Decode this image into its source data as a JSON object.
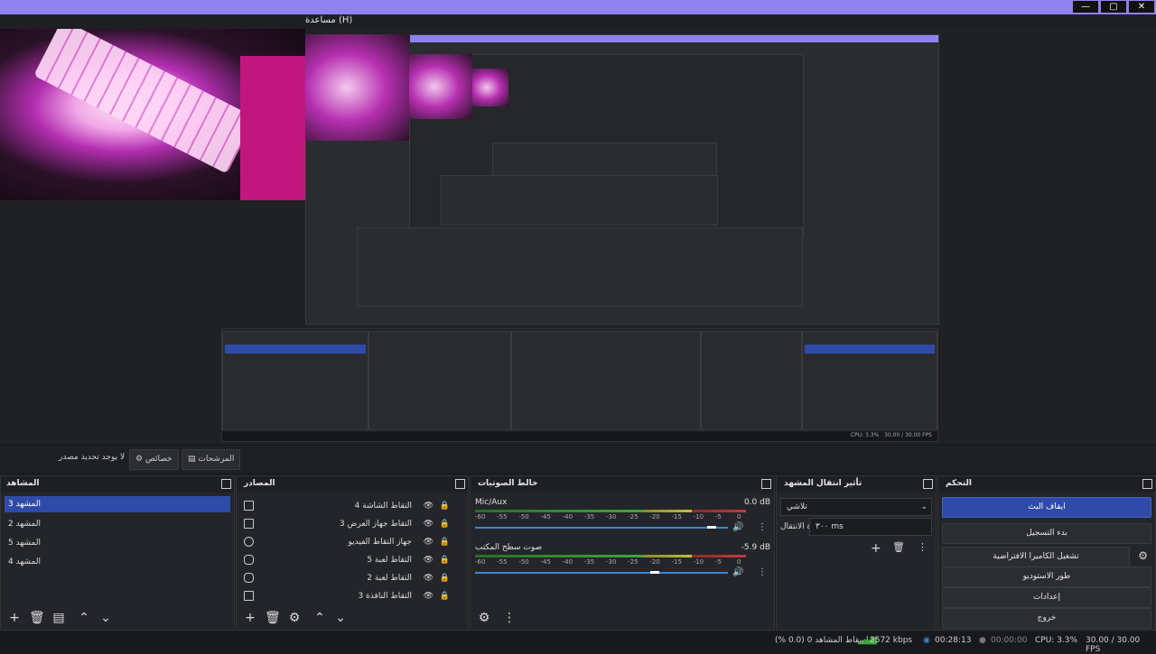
{
  "window": {
    "menu_text": "مساعدة (H)",
    "buttons": [
      "—",
      "▢",
      "✕"
    ]
  },
  "toolbar": {
    "source_label": "لا يوجد تحديد مصدر",
    "properties": "خصائص",
    "filters": "المرشحات"
  },
  "scenes": {
    "title": "المشاهد",
    "items": [
      "المشهد 3",
      "المشهد 2",
      "المشهد 5",
      "المشهد 4"
    ],
    "selected_index": 0
  },
  "sources": {
    "title": "المصادر",
    "items": [
      {
        "name": "التقاط الشاشة 4",
        "icon": "monitor-icon"
      },
      {
        "name": "التقاط جهاز العرض 3",
        "icon": "display-icon"
      },
      {
        "name": "جهاز التقاط الفيديو",
        "icon": "camera-icon"
      },
      {
        "name": "التقاط لعبة 5",
        "icon": "gamepad-icon"
      },
      {
        "name": "التقاط لعبة 2",
        "icon": "gamepad-icon"
      },
      {
        "name": "التقاط النافذة 3",
        "icon": "window-icon"
      }
    ]
  },
  "mixer": {
    "title": "خالط الصوتيات",
    "scale_labels": [
      "-60",
      "-55",
      "-50",
      "-45",
      "-40",
      "-35",
      "-30",
      "-25",
      "-20",
      "-15",
      "-10",
      "-5",
      "0"
    ],
    "channels": [
      {
        "name": "Mic/Aux",
        "db": "0.0 dB",
        "level": 0.95
      },
      {
        "name": "صوت سطح المكتب",
        "db": "-5.9 dB",
        "level": 0.72
      }
    ]
  },
  "transitions": {
    "title": "تأثير انتقال المشهد",
    "type": "تلاشي",
    "duration_label": "مدة الانتقال",
    "duration_value": "٣٠٠ ms"
  },
  "controls": {
    "title": "التحكم",
    "buttons": [
      "ايقاف البث",
      "بدء التسجيل",
      "تشغيل الكاميرا الافتراضية",
      "طور الاستوديو",
      "إعدادات",
      "خروج"
    ]
  },
  "status": {
    "dropped": "إسقاط المشاهد 0 (0.0 %)",
    "bitrate": "2572 kbps",
    "stream_time": "00:28:13",
    "rec_time": "00:00:00",
    "cpu": "CPU: 3.3%",
    "fps": "30.00 / 30.00 FPS"
  },
  "colors": {
    "accent": "#2f4ba8",
    "title_bar": "#8f82ef"
  }
}
